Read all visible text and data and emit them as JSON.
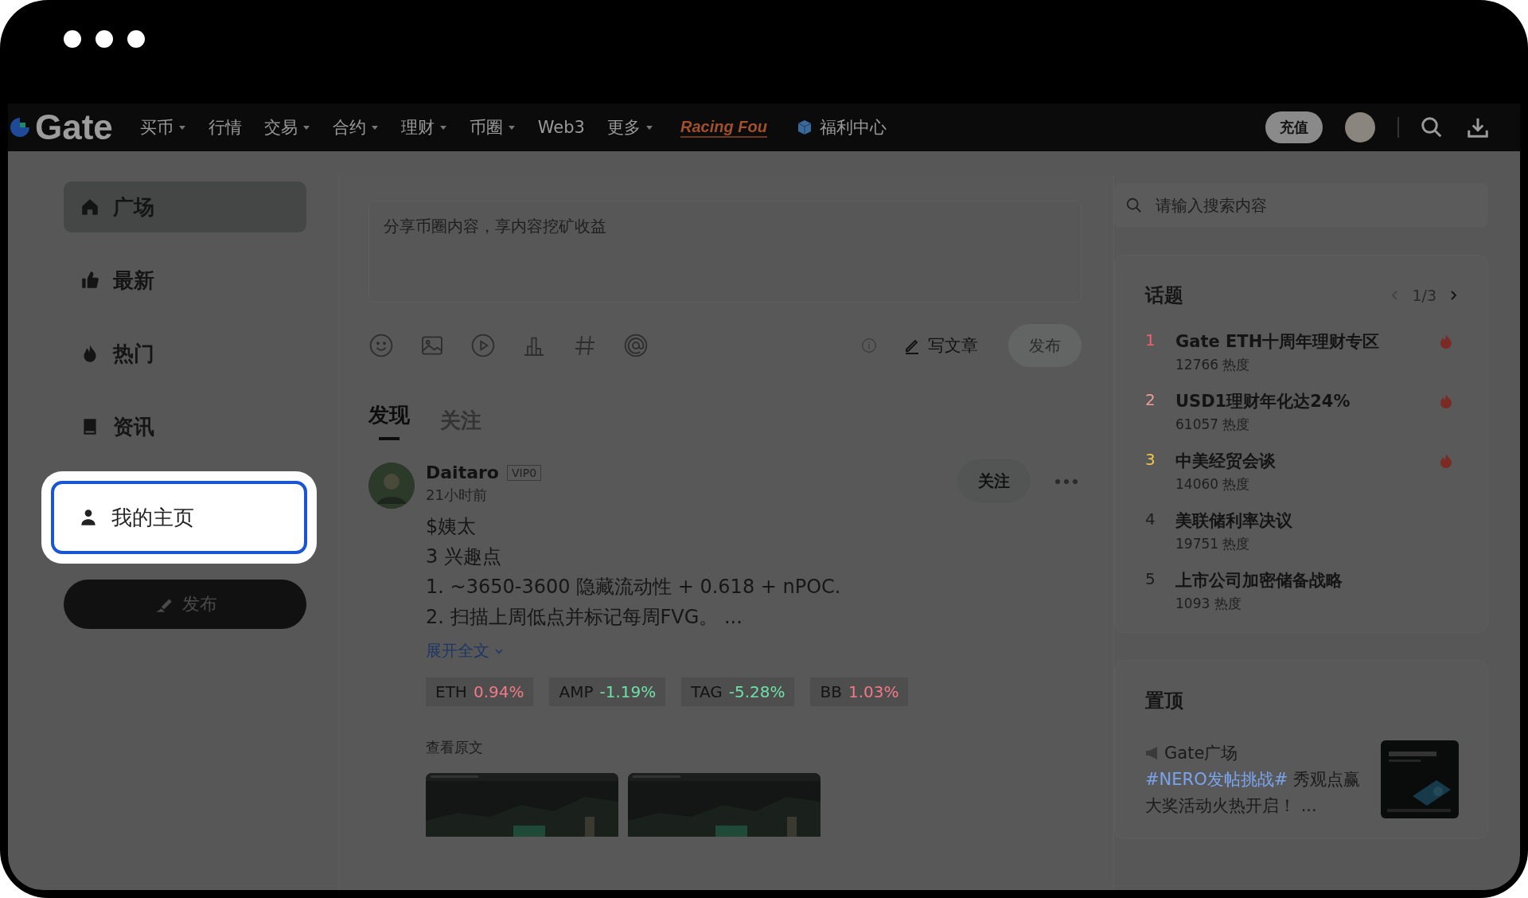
{
  "nav": {
    "logo": "Gate",
    "items": [
      {
        "label": "买币",
        "dropdown": true
      },
      {
        "label": "行情",
        "dropdown": false
      },
      {
        "label": "交易",
        "dropdown": true
      },
      {
        "label": "合约",
        "dropdown": true
      },
      {
        "label": "理财",
        "dropdown": true
      },
      {
        "label": "币圈",
        "dropdown": true
      },
      {
        "label": "Web3",
        "dropdown": false
      },
      {
        "label": "更多",
        "dropdown": true
      }
    ],
    "promo": "Racing Fou",
    "welfare": "福利中心",
    "recharge": "充值"
  },
  "sidebar": {
    "items": [
      {
        "label": "广场",
        "selected": true,
        "highlighted": false
      },
      {
        "label": "最新",
        "selected": false,
        "highlighted": false
      },
      {
        "label": "热门",
        "selected": false,
        "highlighted": false
      },
      {
        "label": "资讯",
        "selected": false,
        "highlighted": false
      },
      {
        "label": "我的主页",
        "selected": false,
        "highlighted": true
      }
    ],
    "publish": "发布"
  },
  "composer": {
    "placeholder": "分享币圈内容，享内容挖矿收益",
    "write_article": "写文章",
    "publish": {
      "label": "发布",
      "disabled": true
    }
  },
  "feed_tabs": [
    {
      "label": "发现",
      "selected": true
    },
    {
      "label": "关注",
      "selected": false
    }
  ],
  "post": {
    "author": "Daitaro",
    "badge": "VIP0",
    "time": "21小时前",
    "follow": "关注",
    "lines": [
      "$姨太",
      "3 兴趣点",
      "1. ~3650-3600 隐藏流动性 + 0.618 + nPOC.",
      "2. 扫描上周低点并标记每周FVG。 ..."
    ],
    "expand": "展开全文",
    "tickers": [
      {
        "symbol": "ETH",
        "change": "0.94%",
        "color": "#f07a88"
      },
      {
        "symbol": "AMP",
        "change": "-1.19%",
        "color": "#6ee0a8"
      },
      {
        "symbol": "TAG",
        "change": "-5.28%",
        "color": "#6ee0a8"
      },
      {
        "symbol": "BB",
        "change": "1.03%",
        "color": "#f07a88"
      }
    ],
    "view_original": "查看原文",
    "images": [
      {
        "kind": "picture"
      },
      {
        "kind": "picture"
      }
    ]
  },
  "search": {
    "placeholder": "请输入搜索内容"
  },
  "topics": {
    "title": "话题",
    "pager": "1/3",
    "items": [
      {
        "rank": "1",
        "color": "#f06070",
        "title": "Gate ETH十周年理财专区",
        "heat": "12766 热度",
        "hot": true
      },
      {
        "rank": "2",
        "color": "#f09a9a",
        "title": "USD1理财年化达24%",
        "heat": "61057 热度",
        "hot": true
      },
      {
        "rank": "3",
        "color": "#f0c848",
        "title": "中美经贸会谈",
        "heat": "14060 热度",
        "hot": true
      },
      {
        "rank": "4",
        "color": "#1c1c1c",
        "title": "美联储利率决议",
        "heat": "19751 热度",
        "hot": false
      },
      {
        "rank": "5",
        "color": "#1c1c1c",
        "title": "上市公司加密储备战略",
        "heat": "1093 热度",
        "hot": false
      }
    ]
  },
  "pinned": {
    "title": "置顶",
    "source": "Gate广场",
    "tag": "#NERO发帖挑战#",
    "text": "秀观点赢大奖活动火热开启！ ..."
  }
}
